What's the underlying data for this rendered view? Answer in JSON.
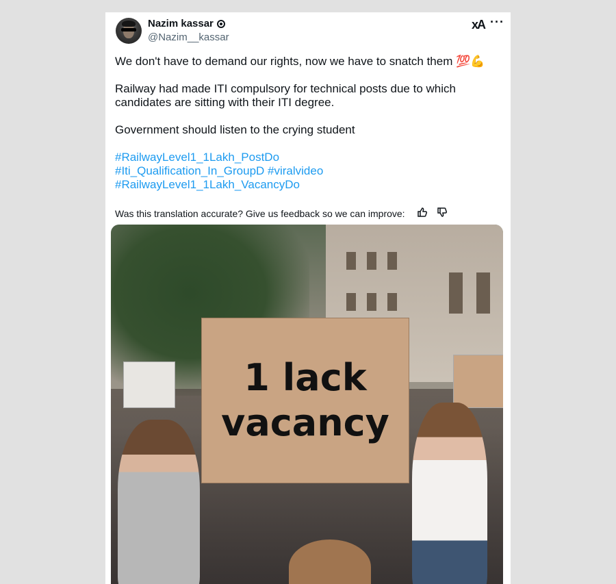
{
  "author": {
    "name": "Nazim kassar",
    "handle": "@Nazim__kassar"
  },
  "header_icons": {
    "grok": "xA",
    "more": "···"
  },
  "post": {
    "line1": "We don't have to demand our rights, now we have to snatch them 💯💪",
    "line2a": "Railway had made ITI compulsory for technical posts due to which",
    "line2b": "candidates are sitting with their ITI degree.",
    "line3": "Government should listen to the crying student",
    "hashtag1": "#RailwayLevel1_1Lakh_PostDo",
    "hashtag2": "#Iti_Qualification_In_GroupD",
    "hashtag3": "#viralvideo",
    "hashtag4": "#RailwayLevel1_1Lakh_VacancyDo"
  },
  "feedback": {
    "prompt": "Was this translation accurate? Give us feedback so we can improve:",
    "up_icon": "thumbs-up-icon",
    "down_icon": "thumbs-down-icon"
  },
  "image": {
    "sign_line1": "1 lack",
    "sign_line2": "vacancy"
  }
}
